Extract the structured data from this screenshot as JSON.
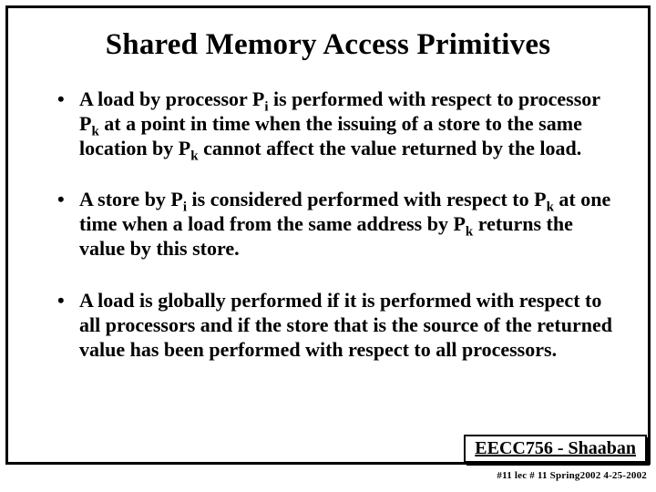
{
  "title": "Shared Memory Access Primitives",
  "bullets": {
    "b1_pre": "A load by processor P",
    "b1_sub1": "i",
    "b1_mid1": "  is performed with respect to processor P",
    "b1_sub2": "k",
    "b1_mid2": " at a point in time when the issuing of a store to the same location by P",
    "b1_sub3": "k",
    "b1_end": " cannot affect the value returned by the load.",
    "b2_pre": "A store by P",
    "b2_sub1": "i",
    "b2_mid1": " is considered performed with respect to P",
    "b2_sub2": "k",
    "b2_mid2": " at one time when a load from  the same address by P",
    "b2_sub3": "k",
    "b2_end": " returns the value by this store.",
    "b3": "A load is globally performed if it is performed with respect to all processors and if the store that is the source of the returned value has been performed with respect to all processors."
  },
  "footer": {
    "box": "EECC756 - Shaaban",
    "line": "#11  lec # 11    Spring2002   4-25-2002"
  }
}
